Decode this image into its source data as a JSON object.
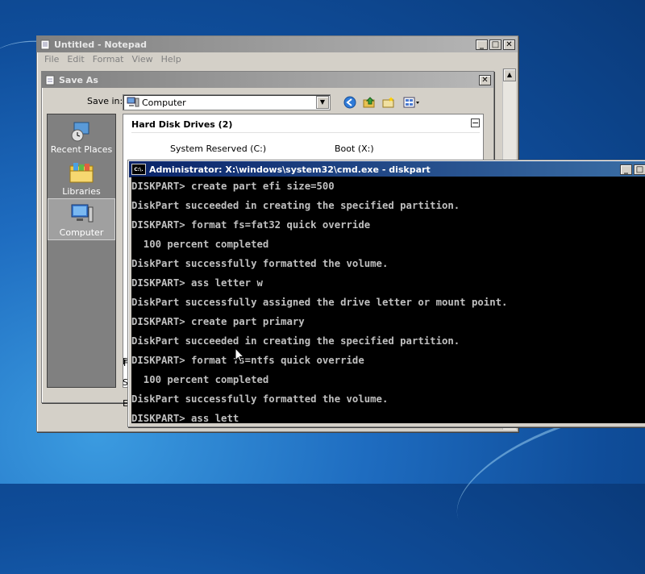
{
  "notepad": {
    "title": "Untitled - Notepad",
    "menu": [
      "File",
      "Edit",
      "Format",
      "View",
      "Help"
    ]
  },
  "save_dialog": {
    "title": "Save As",
    "save_in_label": "Save in:",
    "save_in_value": "Computer",
    "places": [
      {
        "label": "Recent Places",
        "icon": "recent-places-icon"
      },
      {
        "label": "Libraries",
        "icon": "libraries-icon"
      },
      {
        "label": "Computer",
        "icon": "computer-icon"
      }
    ],
    "group_header": "Hard Disk Drives (2)",
    "drives": [
      "System Reserved (C:)",
      "Boot (X:)"
    ],
    "side_letters": [
      "F",
      "S",
      "E"
    ]
  },
  "cmd": {
    "title": "Administrator: X:\\windows\\system32\\cmd.exe - diskpart",
    "icon_text": "C:\\.",
    "lines": [
      "DISKPART> create part efi size=500",
      "DiskPart succeeded in creating the specified partition.",
      "DISKPART> format fs=fat32 quick override",
      "  100 percent completed",
      "DiskPart successfully formatted the volume.",
      "DISKPART> ass letter w",
      "DiskPart successfully assigned the drive letter or mount point.",
      "DISKPART> create part primary",
      "DiskPart succeeded in creating the specified partition.",
      "DISKPART> format fs=ntfs quick override",
      "  100 percent completed",
      "DiskPart successfully formatted the volume.",
      "DISKPART> ass lett"
    ]
  },
  "window_buttons": {
    "minimize": "_",
    "maximize": "□",
    "close": "✕"
  }
}
